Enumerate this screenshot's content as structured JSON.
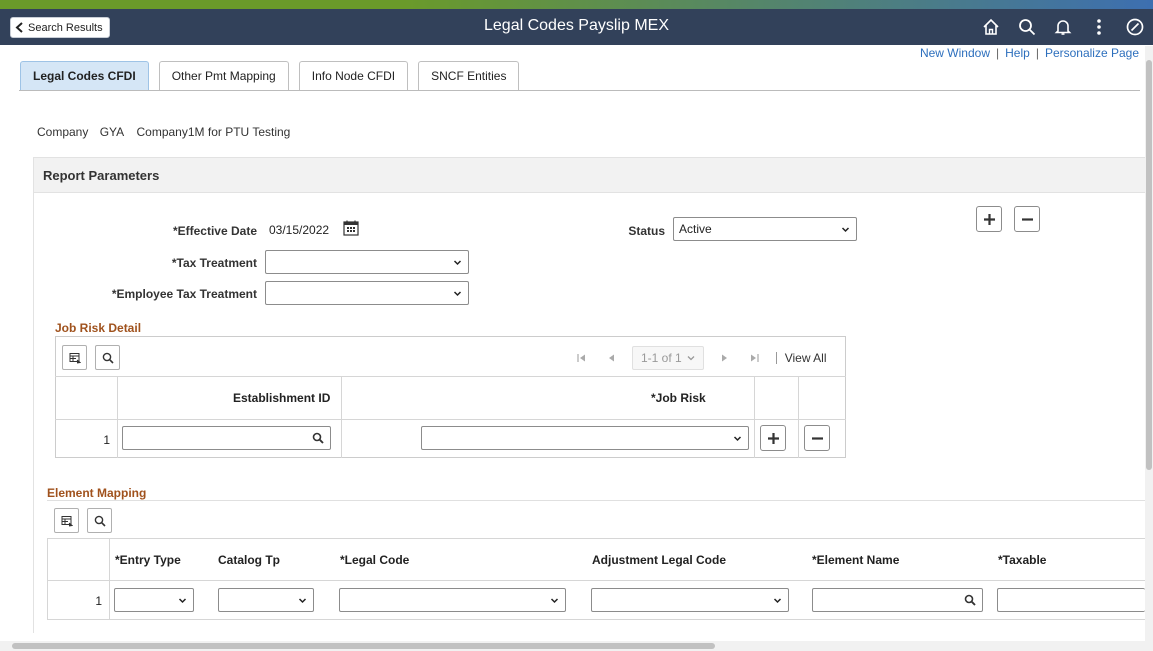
{
  "header": {
    "back_label": "Search Results",
    "title": "Legal Codes Payslip MEX",
    "icons": [
      "home-icon",
      "search-icon",
      "bell-icon",
      "more-icon",
      "navbar-icon"
    ]
  },
  "links": {
    "new_window": "New Window",
    "help": "Help",
    "personalize": "Personalize Page",
    "separator": "|"
  },
  "tabs": [
    {
      "label": "Legal Codes CFDI",
      "active": true
    },
    {
      "label": "Other Pmt Mapping",
      "active": false
    },
    {
      "label": "Info Node CFDI",
      "active": false
    },
    {
      "label": "SNCF Entities",
      "active": false
    }
  ],
  "company": {
    "label": "Company",
    "code": "GYA",
    "name": "Company1M for PTU Testing"
  },
  "report_parameters": {
    "title": "Report Parameters",
    "effective_date_label": "*Effective Date",
    "effective_date": "03/15/2022",
    "status_label": "Status",
    "status_value": "Active",
    "tax_treatment_label": "*Tax Treatment",
    "tax_treatment_value": "",
    "employee_tax_label": "*Employee Tax Treatment",
    "employee_tax_value": ""
  },
  "job_risk": {
    "title": "Job Risk Detail",
    "pager": "1-1 of 1",
    "view_all": "View All",
    "columns": [
      "Establishment ID",
      "*Job Risk"
    ],
    "rows": [
      {
        "num": "1",
        "establishment_id": "",
        "job_risk": ""
      }
    ]
  },
  "element_mapping": {
    "title": "Element Mapping",
    "columns": [
      "*Entry Type",
      "Catalog Tp",
      "*Legal Code",
      "Adjustment Legal Code",
      "*Element Name",
      "*Taxable"
    ],
    "rows": [
      {
        "num": "1"
      }
    ]
  },
  "colors": {
    "banner": "#32415a",
    "tab_active": "#d5e6f6",
    "section_title": "#a0521d",
    "link": "#2d6fbd"
  }
}
